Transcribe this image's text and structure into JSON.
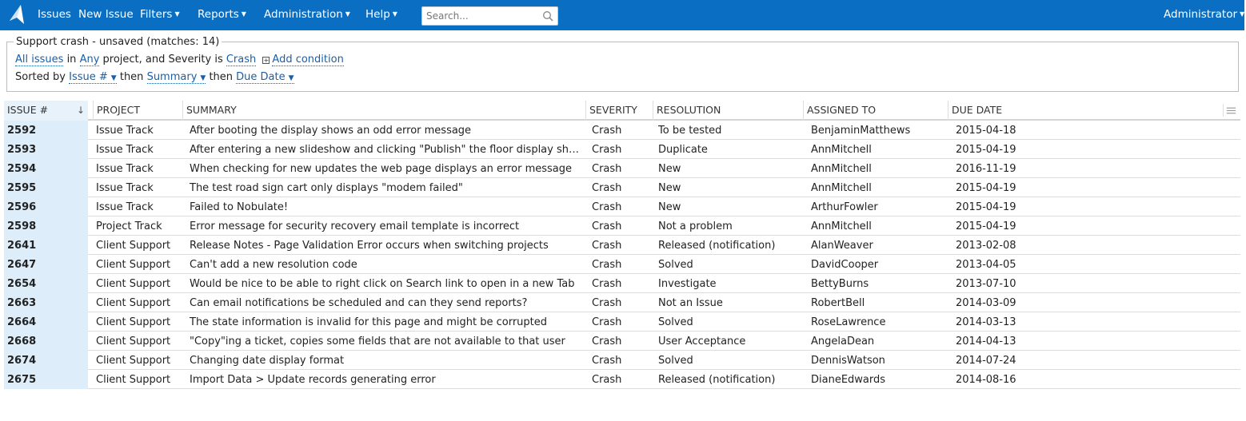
{
  "nav": {
    "items": [
      {
        "label": "Issues",
        "dropdown": false
      },
      {
        "label": "New Issue",
        "dropdown": false
      },
      {
        "label": "Filters",
        "dropdown": true
      },
      {
        "label": "Reports",
        "dropdown": true
      },
      {
        "label": "Administration",
        "dropdown": true
      },
      {
        "label": "Help",
        "dropdown": true
      }
    ],
    "search_placeholder": "Search...",
    "user": "Administrator",
    "bar_color": "#0a6fc2"
  },
  "filter": {
    "title": "Support crash - unsaved (matches: 14)",
    "all_issues": "All issues",
    "in": "in",
    "project_value": "Any",
    "project_text": "project, and Severity is",
    "severity_value": "Crash",
    "add_condition": "Add condition",
    "sorted_by": "Sorted by",
    "sort1": "Issue #",
    "then1": "then",
    "sort2": "Summary",
    "then2": "then",
    "sort3": "Due Date"
  },
  "table": {
    "columns": [
      "ISSUE #",
      "PROJECT",
      "SUMMARY",
      "SEVERITY",
      "RESOLUTION",
      "ASSIGNED TO",
      "DUE DATE"
    ],
    "rows": [
      [
        "2592",
        "Issue Track",
        "After booting the display shows an odd error message",
        "Crash",
        "To be tested",
        "BenjaminMatthews",
        "2015-04-18"
      ],
      [
        "2593",
        "Issue Track",
        "After entering a new slideshow and clicking \"Publish\" the floor display shows the old slideshow",
        "Crash",
        "Duplicate",
        "AnnMitchell",
        "2015-04-19"
      ],
      [
        "2594",
        "Issue Track",
        "When checking for new updates the web page displays an error message",
        "Crash",
        "New",
        "AnnMitchell",
        "2016-11-19"
      ],
      [
        "2595",
        "Issue Track",
        "The test road sign cart only displays \"modem failed\"",
        "Crash",
        "New",
        "AnnMitchell",
        "2015-04-19"
      ],
      [
        "2596",
        "Issue Track",
        "Failed to Nobulate!",
        "Crash",
        "New",
        "ArthurFowler",
        "2015-04-19"
      ],
      [
        "2598",
        "Project Track",
        "Error message for security recovery email template is incorrect",
        "Crash",
        "Not a problem",
        "AnnMitchell",
        "2015-04-19"
      ],
      [
        "2641",
        "Client Support",
        "Release Notes - Page Validation Error occurs when switching projects",
        "Crash",
        "Released (notification)",
        "AlanWeaver",
        "2013-02-08"
      ],
      [
        "2647",
        "Client Support",
        "Can't add a new resolution code",
        "Crash",
        "Solved",
        "DavidCooper",
        "2013-04-05"
      ],
      [
        "2654",
        "Client Support",
        "Would be nice to be able to right click on Search link to open in a new Tab",
        "Crash",
        "Investigate",
        "BettyBurns",
        "2013-07-10"
      ],
      [
        "2663",
        "Client Support",
        "Can email notifications be scheduled and can they send reports?",
        "Crash",
        "Not an Issue",
        "RobertBell",
        "2014-03-09"
      ],
      [
        "2664",
        "Client Support",
        "The state information is invalid for this page and might be corrupted",
        "Crash",
        "Solved",
        "RoseLawrence",
        "2014-03-13"
      ],
      [
        "2668",
        "Client Support",
        "\"Copy\"ing a ticket, copies some fields that are not available to that user",
        "Crash",
        "User Acceptance",
        "AngelaDean",
        "2014-04-13"
      ],
      [
        "2674",
        "Client Support",
        "Changing date display format",
        "Crash",
        "Solved",
        "DennisWatson",
        "2014-07-24"
      ],
      [
        "2675",
        "Client Support",
        "Import Data > Update records generating error",
        "Crash",
        "Released (notification)",
        "DianeEdwards",
        "2014-08-16"
      ]
    ]
  }
}
